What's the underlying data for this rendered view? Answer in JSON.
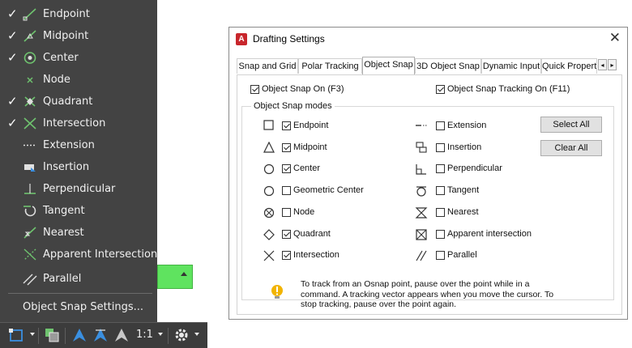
{
  "snap_menu": {
    "items": [
      {
        "label": "Endpoint",
        "checked": true,
        "icon": "endpoint-icon"
      },
      {
        "label": "Midpoint",
        "checked": true,
        "icon": "midpoint-icon"
      },
      {
        "label": "Center",
        "checked": true,
        "icon": "center-icon"
      },
      {
        "label": "Node",
        "checked": false,
        "icon": "node-icon"
      },
      {
        "label": "Quadrant",
        "checked": true,
        "icon": "quadrant-icon"
      },
      {
        "label": "Intersection",
        "checked": true,
        "icon": "intersection-icon"
      },
      {
        "label": "Extension",
        "checked": false,
        "icon": "extension-icon"
      },
      {
        "label": "Insertion",
        "checked": false,
        "icon": "insertion-icon"
      },
      {
        "label": "Perpendicular",
        "checked": false,
        "icon": "perpendicular-icon"
      },
      {
        "label": "Tangent",
        "checked": false,
        "icon": "tangent-icon"
      },
      {
        "label": "Nearest",
        "checked": false,
        "icon": "nearest-icon"
      },
      {
        "label": "Apparent Intersection",
        "checked": false,
        "icon": "apparent-intersection-icon"
      },
      {
        "label": "Parallel",
        "checked": false,
        "icon": "parallel-icon"
      }
    ],
    "checkmark": "✓",
    "settings_label": "Object Snap Settings..."
  },
  "toolbar": {
    "scale_label": "1:1"
  },
  "dialog": {
    "title": "Drafting Settings",
    "app_icon_letter": "A",
    "close_glyph": "✕",
    "tabs": [
      "Snap and Grid",
      "Polar Tracking",
      "Object Snap",
      "3D Object Snap",
      "Dynamic Input",
      "Quick Propert"
    ],
    "active_tab": "Object Snap",
    "tab_scroll_left": "◂",
    "tab_scroll_right": "▸",
    "snap_on_label": "Object Snap On (F3)",
    "snap_on": true,
    "tracking_on_label": "Object Snap Tracking On (F11)",
    "tracking_on": true,
    "group_label": "Object Snap modes",
    "modes_left": [
      {
        "label": "Endpoint",
        "checked": true,
        "icon": "endpoint-marker-icon"
      },
      {
        "label": "Midpoint",
        "checked": true,
        "icon": "midpoint-marker-icon"
      },
      {
        "label": "Center",
        "checked": true,
        "icon": "center-marker-icon"
      },
      {
        "label": "Geometric Center",
        "checked": false,
        "icon": "geometric-center-marker-icon"
      },
      {
        "label": "Node",
        "checked": false,
        "icon": "node-marker-icon"
      },
      {
        "label": "Quadrant",
        "checked": true,
        "icon": "quadrant-marker-icon"
      },
      {
        "label": "Intersection",
        "checked": true,
        "icon": "intersection-marker-icon"
      }
    ],
    "modes_right": [
      {
        "label": "Extension",
        "checked": false,
        "icon": "extension-marker-icon"
      },
      {
        "label": "Insertion",
        "checked": false,
        "icon": "insertion-marker-icon"
      },
      {
        "label": "Perpendicular",
        "checked": false,
        "icon": "perpendicular-marker-icon"
      },
      {
        "label": "Tangent",
        "checked": false,
        "icon": "tangent-marker-icon"
      },
      {
        "label": "Nearest",
        "checked": false,
        "icon": "nearest-marker-icon"
      },
      {
        "label": "Apparent intersection",
        "checked": false,
        "icon": "apparent-intersection-marker-icon"
      },
      {
        "label": "Parallel",
        "checked": false,
        "icon": "parallel-marker-icon"
      }
    ],
    "select_all_label": "Select All",
    "clear_all_label": "Clear All",
    "tip_text": "To track from an Osnap point, pause over the point while in a command.  A tracking vector appears when you move the cursor.  To stop tracking, pause over the point again."
  },
  "colors": {
    "menu_bg": "#434343",
    "highlight_green": "#5fe35f",
    "toolbar_blue": "#3a8fe0",
    "autocad_red": "#c8262c",
    "tip_yellow": "#f2b400"
  }
}
